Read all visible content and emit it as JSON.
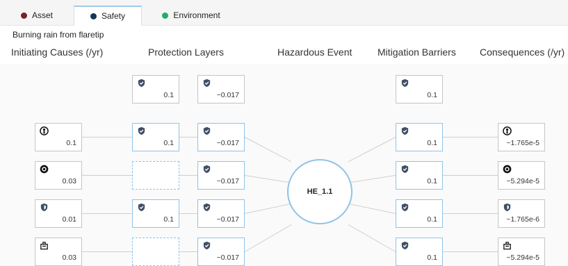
{
  "tabs": [
    {
      "label": "Asset",
      "color": "#7a1f2b"
    },
    {
      "label": "Safety",
      "color": "#12355b"
    },
    {
      "label": "Environment",
      "color": "#1fae6a"
    }
  ],
  "active_tab": "Safety",
  "subtitle": "Burning rain from flaretip",
  "columns": {
    "initiating": "Initiating Causes (/yr)",
    "protection": "Protection Layers",
    "event": "Hazardous Event",
    "mitigation": "Mitigation Barriers",
    "consequences": "Consequences (/yr)"
  },
  "hazardous_event": "HE_1.1",
  "top_row": {
    "protection": [
      {
        "value": "0.1"
      },
      {
        "value": "~0.017"
      }
    ],
    "mitigation": {
      "value": "0.1"
    }
  },
  "rows": [
    {
      "cause": {
        "icon": "person-icon",
        "value": "0.1"
      },
      "protection": [
        {
          "value": "0.1"
        },
        {
          "value": "~0.017"
        }
      ],
      "mitigation": {
        "value": "0.1"
      },
      "consequence": {
        "icon": "person-icon",
        "value": "~1.765e-5"
      }
    },
    {
      "cause": {
        "icon": "target-icon",
        "value": "0.03"
      },
      "protection": [
        null,
        {
          "value": "~0.017"
        }
      ],
      "mitigation": {
        "value": "0.1"
      },
      "consequence": {
        "icon": "target-icon",
        "value": "~5.294e-5"
      }
    },
    {
      "cause": {
        "icon": "shield-icon",
        "value": "0.01"
      },
      "protection": [
        {
          "value": "0.1"
        },
        {
          "value": "~0.017"
        }
      ],
      "mitigation": {
        "value": "0.1"
      },
      "consequence": {
        "icon": "shield-icon",
        "value": "~1.765e-6"
      }
    },
    {
      "cause": {
        "icon": "facility-icon",
        "value": "0.03"
      },
      "protection": [
        null,
        {
          "value": "~0.017"
        }
      ],
      "mitigation": {
        "value": "0.1"
      },
      "consequence": {
        "icon": "facility-icon",
        "value": "~5.294e-5"
      }
    }
  ]
}
